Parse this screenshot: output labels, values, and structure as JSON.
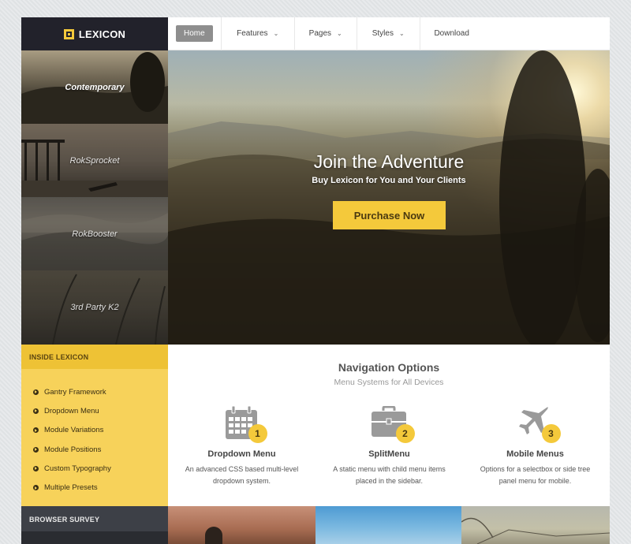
{
  "logo": {
    "text": "LEXICON"
  },
  "nav": {
    "home": "Home",
    "features": "Features",
    "pages": "Pages",
    "styles": "Styles",
    "download": "Download"
  },
  "showcase": {
    "items": [
      {
        "label": "Contemporary"
      },
      {
        "label": "RokSprocket"
      },
      {
        "label": "RokBooster"
      },
      {
        "label": "3rd Party K2"
      }
    ]
  },
  "hero": {
    "title": "Join the Adventure",
    "subtitle": "Buy Lexicon for You and Your Clients",
    "button": "Purchase Now"
  },
  "sidebar": {
    "heading": "INSIDE LEXICON",
    "items": [
      "Gantry Framework",
      "Dropdown Menu",
      "Module Variations",
      "Module Positions",
      "Custom Typography",
      "Multiple Presets"
    ],
    "survey_heading": "BROWSER SURVEY"
  },
  "section": {
    "title": "Navigation Options",
    "subtitle": "Menu Systems for All Devices",
    "features": [
      {
        "number": "1",
        "icon": "calendar-icon",
        "title": "Dropdown Menu",
        "desc": "An advanced CSS based multi-level dropdown system."
      },
      {
        "number": "2",
        "icon": "briefcase-icon",
        "title": "SplitMenu",
        "desc": "A static menu with child menu items placed in the sidebar."
      },
      {
        "number": "3",
        "icon": "airplane-icon",
        "title": "Mobile Menus",
        "desc": "Options for a selectbox or side tree panel menu for mobile."
      }
    ]
  },
  "colors": {
    "accent": "#f4c93b",
    "header_dark": "#22222b",
    "survey_dark": "#3d4047"
  }
}
